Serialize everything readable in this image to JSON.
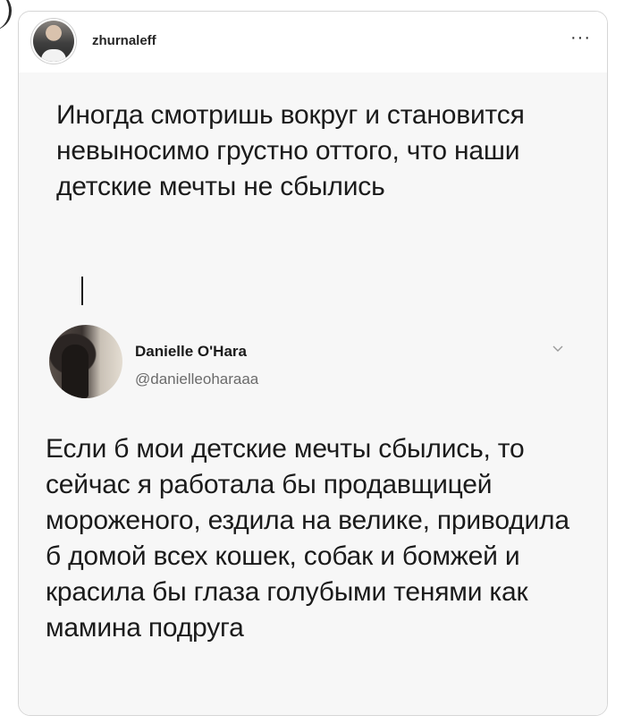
{
  "post": {
    "username": "zhurnaleff",
    "more_icon": "more-horizontal-icon",
    "more_glyph": "···"
  },
  "tweet": {
    "text": "Иногда смотришь вокруг и становится невыносимо грустно оттого, что наши детские мечты не сбылись"
  },
  "reply": {
    "name": "Danielle O'Hara",
    "handle": "@danielleoharaaa",
    "chevron_icon": "chevron-down-icon",
    "text": "Если б мои детские мечты сбылись, то сейчас я работала бы продавщицей мороженого, ездила на велике, приводила б домой всех кошек, собак и бомжей и красила бы глаза голубыми тенями как мамина подруга"
  },
  "colors": {
    "text": "#1b1b1b",
    "muted": "#6b6b6b",
    "content_bg": "#f7f7f7",
    "card_border": "#d6d6d6"
  }
}
